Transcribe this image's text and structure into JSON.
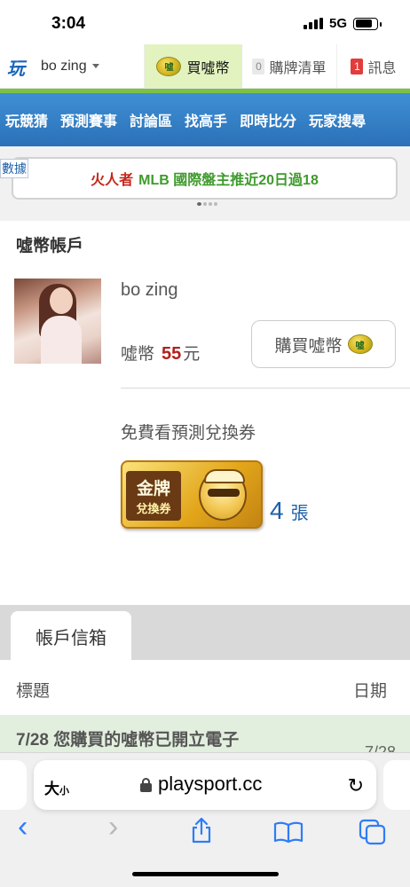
{
  "status": {
    "time": "3:04",
    "network": "5G"
  },
  "topnav": {
    "logo": "玩",
    "username": "bo zing",
    "buy_coin": "買噓幣",
    "cart_count": "0",
    "cart_label": "購牌清單",
    "msg_count": "1",
    "msg_label": "訊息"
  },
  "menu": [
    "玩競猜",
    "預測賽事",
    "討論區",
    "找高手",
    "即時比分",
    "玩家搜尋"
  ],
  "ticker": {
    "side_label": "數據",
    "player": "火人者",
    "text": "MLB 國際盤主推近20日過18"
  },
  "account": {
    "title": "噓幣帳戶",
    "username": "bo zing",
    "coin_label": "噓幣",
    "coin_amount": "55",
    "coin_unit": "元",
    "buy_button": "購買噓幣",
    "coin_icon": "噓",
    "voucher_title": "免費看預測兌換券",
    "voucher_line1": "金牌",
    "voucher_line2": "兌換券",
    "voucher_count": "4",
    "voucher_unit": "張"
  },
  "mailbox": {
    "tab": "帳戶信箱",
    "col_title": "標題",
    "col_date": "日期",
    "rows": [
      {
        "title": "7/28 您購買的噓幣已開立電子",
        "date": "7/28"
      }
    ]
  },
  "browser": {
    "text_size": "大",
    "text_size_small": "小",
    "domain": "playsport.cc",
    "back_icon": "‹",
    "forward_icon": "›"
  }
}
